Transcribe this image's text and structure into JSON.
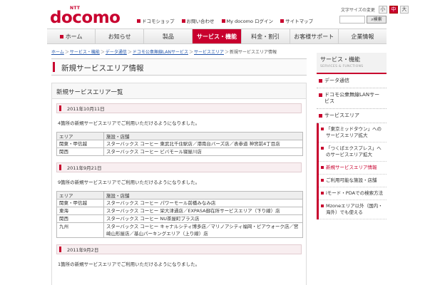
{
  "header": {
    "logo_small": "NTT",
    "logo_text": "docomo",
    "font_size_label": "文字サイズの変更",
    "font_size_options": [
      "小",
      "中",
      "大"
    ],
    "top_links": [
      "ドコモショップ",
      "お問い合わせ",
      "My docomo ログイン",
      "サイトマップ"
    ],
    "search_button": "検索"
  },
  "nav": {
    "items": [
      "ホーム",
      "お知らせ",
      "製品",
      "サービス・機能",
      "料金・割引",
      "お客様サポート",
      "企業情報"
    ],
    "active_index": 3
  },
  "breadcrumb": {
    "items": [
      "ホーム",
      "サービス・機能",
      "データ通信",
      "ドコモ公衆無線LANサービス",
      "サービスエリア",
      "新規サービスエリア情報"
    ],
    "separator": "＞"
  },
  "page_title": "新規サービスエリア情報",
  "section": {
    "title": "新規サービスエリア一覧",
    "col_area": "エリア",
    "col_venue": "施設・店舗",
    "groups": [
      {
        "date": "2011年10月11日",
        "intro": "4箇所の新規サービスエリアでご利用いただけるようになりました。",
        "rows": [
          {
            "area": "関東・甲信越",
            "venue": "スターバックス コーヒー 東武北千住駅店／港南台バーズ店／表参道 神宮前4丁目店"
          },
          {
            "area": "関西",
            "venue": "スターバックス コーヒー ビバモール寝屋川店"
          }
        ]
      },
      {
        "date": "2011年9月21日",
        "intro": "9箇所の新規サービスエリアでご利用いただけるようになりました。",
        "rows": [
          {
            "area": "関東・甲信越",
            "venue": "スターバックス コーヒー パワーモール前橋みなみ店"
          },
          {
            "area": "東海",
            "venue": "スターバックス コーヒー 栄大津通店／EXPASA御在所サービスエリア（下り線）店"
          },
          {
            "area": "関西",
            "venue": "スターバックス コーヒー NU茶屋町プラス店"
          },
          {
            "area": "九州",
            "venue": "スターバックス コーヒー キャナルシティ博多店／マリノアシティ福岡・ピアウォーク店／宮崎山形屋店／基山パーキングエリア（上り線）店"
          }
        ]
      },
      {
        "date": "2011年9月2日",
        "intro": "1箇所の新規サービスエリアでご利用いただけるようになりました。",
        "rows": []
      }
    ]
  },
  "sidebar": {
    "title": "サービス・機能",
    "subtitle": "SERVICES & FUNCTIONS",
    "categories": [
      "データ通信",
      "ドコモ公衆無線LANサービス",
      "サービスエリア"
    ],
    "subitems": [
      "「東京ミッドタウン」へのサービスエリア拡大",
      "「つくばエクスプレス」へのサービスエリア拡大",
      "新規サービスエリア情報",
      "ご利用可能な施設・店舗",
      "iモード・PDAでの検索方法",
      "Mzoneエリア以外（国内・海外）でも使える"
    ],
    "active_subitem": 2
  },
  "colors": {
    "brand": "#c8002e",
    "nav_bg": "#efefef"
  }
}
